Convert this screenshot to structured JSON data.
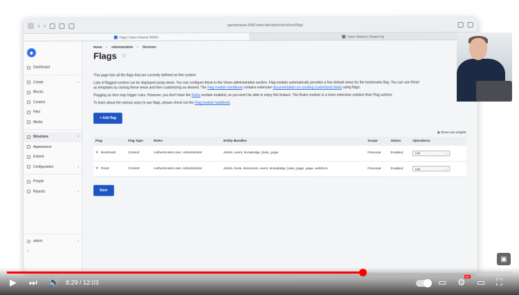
{
  "browser": {
    "url": "openintranet-3006.ddev.site/admin/structure/flags",
    "tabs": [
      "Flags | Open Intranet 3006D",
      "Open Intranet | Drupal.org"
    ]
  },
  "sidebar": {
    "logo_icon": "drupal-drop-icon",
    "items": [
      {
        "label": "Dashboard",
        "icon": "dashboard-icon",
        "chevron": ""
      },
      {
        "label": "Create",
        "icon": "plus-icon",
        "chevron": "›"
      },
      {
        "label": "Blocks",
        "icon": "blocks-icon",
        "chevron": ""
      },
      {
        "label": "Content",
        "icon": "content-icon",
        "chevron": ""
      },
      {
        "label": "Files",
        "icon": "files-icon",
        "chevron": ""
      },
      {
        "label": "Media",
        "icon": "media-icon",
        "chevron": ""
      },
      {
        "label": "Structure",
        "icon": "structure-icon",
        "chevron": "›"
      },
      {
        "label": "Appearance",
        "icon": "appearance-icon",
        "chevron": ""
      },
      {
        "label": "Extend",
        "icon": "extend-icon",
        "chevron": ""
      },
      {
        "label": "Configuration",
        "icon": "configuration-icon",
        "chevron": "›"
      },
      {
        "label": "People",
        "icon": "people-icon",
        "chevron": ""
      },
      {
        "label": "Reports",
        "icon": "reports-icon",
        "chevron": "›"
      }
    ],
    "user": "admin"
  },
  "breadcrumb": [
    "Home",
    "Administration",
    "Structure"
  ],
  "page_title": "Flags",
  "intro": {
    "p1": "This page lists all the flags that are currently defined on this system.",
    "p2_a": "Lists of flagged content can be displayed using views. You can configure these in the Views administration section. Flag module automatically provides a few default views for the bookmarks flag. You can use these",
    "p2_b": "as templates by cloning these views and then customizing as desired. The",
    "p2_link1": "Flag module handbook",
    "p2_c": "contains extensive",
    "p2_link2": "documentation on creating customized views",
    "p2_d": "using flags.",
    "p3_a": "Flagging an item may trigger rules. However, you don't have the",
    "p3_link": "Rules",
    "p3_b": "module enabled, so you won't be able to enjoy this feature. The Rules module is a more extensive solution than Flag actions.",
    "p4_a": "To learn about the various ways to use flags, please check out the",
    "p4_link": "Flag module handbook",
    "p4_b": "."
  },
  "add_flag_label": "+ Add flag",
  "show_row_weights": "Show row weights",
  "table": {
    "headers": [
      "Flag",
      "Flag Type",
      "Roles",
      "Entity Bundles",
      "Scope",
      "Status",
      "Operations"
    ],
    "rows": [
      {
        "flag": "Bookmark",
        "type": "Content",
        "roles": "Authenticated user, Administrator",
        "bundles": "article, event, knowledge_base_page",
        "scope": "Personal",
        "status": "Enabled",
        "op": "Edit"
      },
      {
        "flag": "Read",
        "type": "Content",
        "roles": "Authenticated user, Administrator",
        "bundles": "article, book, document, event, knowledge_base_page, page, webform",
        "scope": "Personal",
        "status": "Enabled",
        "op": "Edit"
      }
    ]
  },
  "save_label": "Save",
  "player": {
    "time": "8:29 / 12:03",
    "progress": 0.704,
    "hd_badge": "HD",
    "accent": "#ff0000"
  }
}
